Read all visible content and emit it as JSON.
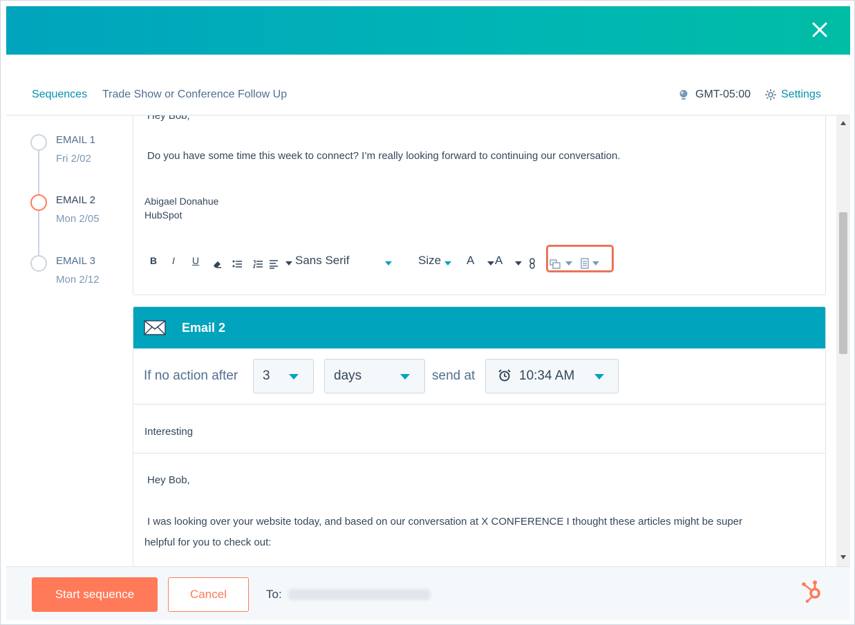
{
  "breadcrumb": {
    "root": "Sequences",
    "current": "Trade Show or Conference Follow Up"
  },
  "header": {
    "timezone": "GMT-05:00",
    "settings_label": "Settings"
  },
  "colors": {
    "accent": "#00a4bd",
    "orange": "#ff7a59",
    "text": "#33475b",
    "link": "#0091ae"
  },
  "timeline": [
    {
      "label": "EMAIL 1",
      "date": "Fri 2/02"
    },
    {
      "label": "EMAIL 2",
      "date": "Mon 2/05"
    },
    {
      "label": "EMAIL 3",
      "date": "Mon 2/12"
    }
  ],
  "email1": {
    "greeting": "Hey Bob,",
    "body": "Do you have some time this week to connect? I’m really looking forward to continuing our conversation.",
    "signature_name": "Abigael Donahue",
    "signature_company": "HubSpot"
  },
  "toolbar": {
    "bold": "B",
    "italic": "I",
    "underline": "U",
    "font": "Sans Serif",
    "size": "Size",
    "text_color": "A",
    "bg_color": "A",
    "icons": [
      "bold-icon",
      "italic-icon",
      "underline-icon",
      "clear-format-icon",
      "bullet-list-icon",
      "numbered-list-icon",
      "align-icon",
      "link-icon",
      "snippets-icon",
      "documents-icon"
    ]
  },
  "email2": {
    "title": "Email 2",
    "delay_prefix": "If no action after",
    "delay_value": "3",
    "delay_unit": "days",
    "send_at_label": "send at",
    "send_time": "10:34 AM",
    "subject": "Interesting",
    "greeting": "Hey Bob,",
    "body_line1": "I was looking over your website today, and based on our conversation at X CONFERENCE I thought these articles might be super",
    "body_line2": "helpful for you to check out:"
  },
  "footer": {
    "start_label": "Start sequence",
    "cancel_label": "Cancel",
    "to_label": "To:"
  }
}
